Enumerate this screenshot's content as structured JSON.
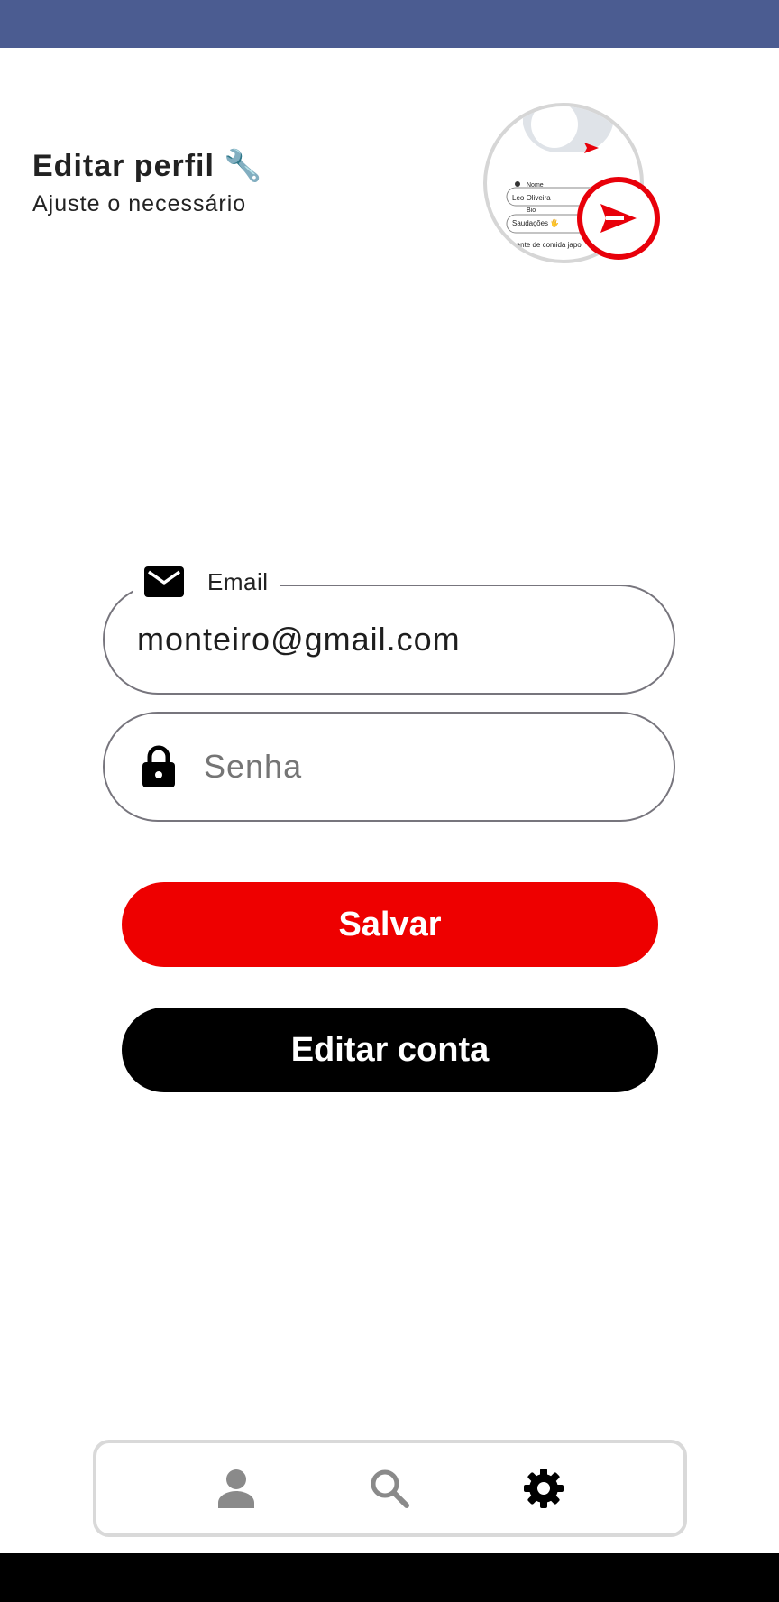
{
  "header": {
    "title": "Editar perfil",
    "title_emoji": "🔧",
    "subtitle": "Ajuste o necessário"
  },
  "avatar": {
    "preview_name_label": "Nome",
    "preview_name_value": "Leo Oliveira",
    "preview_bio_label": "Bio",
    "preview_bio_value": "Saudações 🖐",
    "preview_extra": "mante de comida japo",
    "icon": "send-icon"
  },
  "form": {
    "email": {
      "label": "Email",
      "value": "monteiro@gmail.com",
      "icon": "mail-icon"
    },
    "password": {
      "placeholder": "Senha",
      "icon": "lock-icon"
    }
  },
  "buttons": {
    "save_label": "Salvar",
    "edit_account_label": "Editar conta"
  },
  "nav": {
    "items": [
      {
        "icon": "person-icon",
        "active": false
      },
      {
        "icon": "search-icon",
        "active": false
      },
      {
        "icon": "settings-icon",
        "active": true
      }
    ]
  },
  "colors": {
    "status_bar": "#4b5c91",
    "primary_red": "#ee0000",
    "dark_button": "#000000",
    "field_border": "#77757d",
    "nav_inactive": "#8a8a8a"
  }
}
